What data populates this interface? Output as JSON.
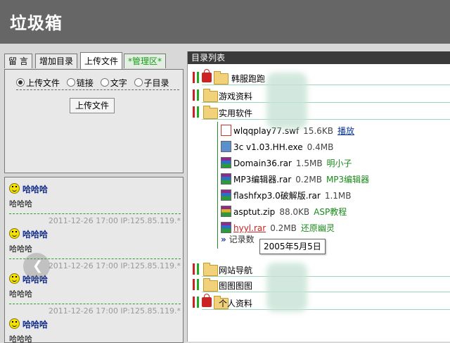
{
  "header": {
    "title": "垃圾箱"
  },
  "tabs": [
    {
      "label": "留 言"
    },
    {
      "label": "增加目录"
    },
    {
      "label": "上传文件"
    },
    {
      "label": "*管理区*"
    }
  ],
  "upload": {
    "options": [
      "上传文件",
      "链接",
      "文字",
      "子目录"
    ],
    "button_label": "上传文件"
  },
  "messages": [
    {
      "name": "哈哈哈",
      "body": "哈哈哈",
      "meta": "2011-12-26 17:00 IP:125.85.119.*"
    },
    {
      "name": "哈哈哈",
      "body": "哈哈哈",
      "meta": "2011-12-26 17:00 IP:125.85.119.*"
    },
    {
      "name": "哈哈哈",
      "body": "哈哈哈",
      "meta": "2011-12-26 17:00 IP:125.85.119.*"
    },
    {
      "name": "哈哈哈",
      "body": "哈哈哈"
    }
  ],
  "directory": {
    "heading": "目录列表",
    "top_folders": [
      {
        "label": "韩服跑跑",
        "locked": true
      },
      {
        "label": "游戏资料",
        "locked": false
      },
      {
        "label": "实用软件",
        "locked": false
      }
    ],
    "files": [
      {
        "name": "wlqqplay77.swf",
        "size": "15.6KB",
        "desc": "播放",
        "icon": "swf"
      },
      {
        "name": "3c v1.03.HH.exe",
        "size": "0.4MB",
        "desc": "",
        "icon": "exe"
      },
      {
        "name": "Domain36.rar",
        "size": "1.5MB",
        "desc": "明小子",
        "icon": "rar"
      },
      {
        "name": "MP3编辑器.rar",
        "size": "0.2MB",
        "desc": "MP3编辑器",
        "icon": "rar"
      },
      {
        "name": "flashfxp3.0破解版.rar",
        "size": "1.1MB",
        "desc": "",
        "icon": "rar"
      },
      {
        "name": "asptut.zip",
        "size": "88.0KB",
        "desc": "ASP教程",
        "icon": "zip"
      },
      {
        "name": "hyyl.rar",
        "size": "0.2MB",
        "desc": "还原幽灵",
        "icon": "rar"
      }
    ],
    "more_label": "记录数",
    "bottom_folders": [
      {
        "label": "网站导航",
        "locked": false
      },
      {
        "label": "图图图图",
        "locked": false
      },
      {
        "label": "个人资料",
        "locked": true
      }
    ],
    "tooltip": "2005年5月5日"
  },
  "colors": {
    "header_bg": "#666666",
    "admin_tab": "#1a9a1a",
    "link_blue": "#123a9a"
  }
}
